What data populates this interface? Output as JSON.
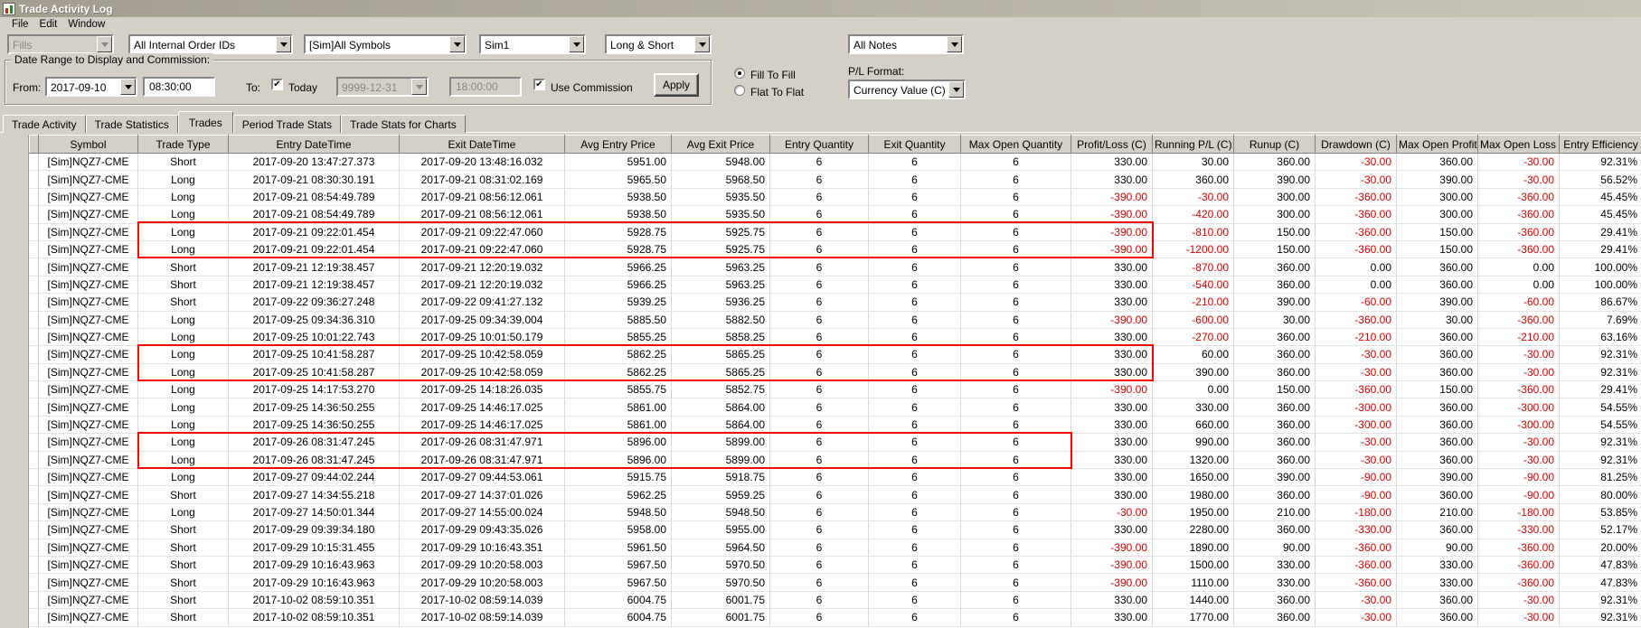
{
  "colors": {
    "negative": "#dd0000",
    "annotation": "#ff0000"
  },
  "window": {
    "title": "Trade Activity Log",
    "menu": [
      "File",
      "Edit",
      "Window"
    ]
  },
  "filters": {
    "fills": "Fills",
    "internal_order_ids": "All Internal Order IDs",
    "symbol": "[Sim]All Symbols",
    "account": "Sim1",
    "direction": "Long & Short",
    "notes": "All Notes"
  },
  "date_range": {
    "group_label": "Date Range to Display and Commission:",
    "from_label": "From:",
    "from_date": "2017-09-10",
    "from_time": "08:30:00",
    "to_label": "To:",
    "today_checkbox": "Today",
    "to_date": "9999-12-31",
    "to_time": "18:00:00",
    "use_commission_checkbox": "Use Commission",
    "apply_button": "Apply"
  },
  "pl_settings": {
    "fill_to_fill": "Fill To Fill",
    "flat_to_flat": "Flat To Flat",
    "format_label": "P/L Format:",
    "format_value": "Currency Value (C)"
  },
  "tabs": {
    "items": [
      "Trade Activity",
      "Trade Statistics",
      "Trades",
      "Period Trade Stats",
      "Trade Stats for Charts"
    ],
    "active": "Trades"
  },
  "table": {
    "columns": [
      "Symbol",
      "Trade Type",
      "Entry DateTime",
      "Exit DateTime",
      "Avg Entry Price",
      "Avg Exit Price",
      "Entry Quantity",
      "Exit Quantity",
      "Max Open Quantity",
      "Profit/Loss (C)",
      "Running P/L (C)",
      "Runup (C)",
      "Drawdown (C)",
      "Max Open Profit (C)",
      "Max Open Loss (C)",
      "Entry Efficiency"
    ],
    "rows": [
      [
        "[Sim]NQZ7-CME",
        "Short",
        "2017-09-20 13:47:27.373",
        "2017-09-20 13:48:16.032",
        "5951.00",
        "5948.00",
        "6",
        "6",
        "6",
        "330.00",
        "30.00",
        "360.00",
        "-30.00",
        "360.00",
        "-30.00",
        "92.31%"
      ],
      [
        "[Sim]NQZ7-CME",
        "Long",
        "2017-09-21 08:30:30.191",
        "2017-09-21 08:31:02.169",
        "5965.50",
        "5968.50",
        "6",
        "6",
        "6",
        "330.00",
        "360.00",
        "390.00",
        "-30.00",
        "390.00",
        "-30.00",
        "56.52%"
      ],
      [
        "[Sim]NQZ7-CME",
        "Long",
        "2017-09-21 08:54:49.789",
        "2017-09-21 08:56:12.061",
        "5938.50",
        "5935.50",
        "6",
        "6",
        "6",
        "-390.00",
        "-30.00",
        "300.00",
        "-360.00",
        "300.00",
        "-360.00",
        "45.45%"
      ],
      [
        "[Sim]NQZ7-CME",
        "Long",
        "2017-09-21 08:54:49.789",
        "2017-09-21 08:56:12.061",
        "5938.50",
        "5935.50",
        "6",
        "6",
        "6",
        "-390.00",
        "-420.00",
        "300.00",
        "-360.00",
        "300.00",
        "-360.00",
        "45.45%"
      ],
      [
        "[Sim]NQZ7-CME",
        "Long",
        "2017-09-21 09:22:01.454",
        "2017-09-21 09:22:47.060",
        "5928.75",
        "5925.75",
        "6",
        "6",
        "6",
        "-390.00",
        "-810.00",
        "150.00",
        "-360.00",
        "150.00",
        "-360.00",
        "29.41%"
      ],
      [
        "[Sim]NQZ7-CME",
        "Long",
        "2017-09-21 09:22:01.454",
        "2017-09-21 09:22:47.060",
        "5928.75",
        "5925.75",
        "6",
        "6",
        "6",
        "-390.00",
        "-1200.00",
        "150.00",
        "-360.00",
        "150.00",
        "-360.00",
        "29.41%"
      ],
      [
        "[Sim]NQZ7-CME",
        "Short",
        "2017-09-21 12:19:38.457",
        "2017-09-21 12:20:19.032",
        "5966.25",
        "5963.25",
        "6",
        "6",
        "6",
        "330.00",
        "-870.00",
        "360.00",
        "0.00",
        "360.00",
        "0.00",
        "100.00%"
      ],
      [
        "[Sim]NQZ7-CME",
        "Short",
        "2017-09-21 12:19:38.457",
        "2017-09-21 12:20:19.032",
        "5966.25",
        "5963.25",
        "6",
        "6",
        "6",
        "330.00",
        "-540.00",
        "360.00",
        "0.00",
        "360.00",
        "0.00",
        "100.00%"
      ],
      [
        "[Sim]NQZ7-CME",
        "Short",
        "2017-09-22 09:36:27.248",
        "2017-09-22 09:41:27.132",
        "5939.25",
        "5936.25",
        "6",
        "6",
        "6",
        "330.00",
        "-210.00",
        "390.00",
        "-60.00",
        "390.00",
        "-60.00",
        "86.67%"
      ],
      [
        "[Sim]NQZ7-CME",
        "Long",
        "2017-09-25 09:34:36.310",
        "2017-09-25 09:34:39.004",
        "5885.50",
        "5882.50",
        "6",
        "6",
        "6",
        "-390.00",
        "-600.00",
        "30.00",
        "-360.00",
        "30.00",
        "-360.00",
        "7.69%"
      ],
      [
        "[Sim]NQZ7-CME",
        "Long",
        "2017-09-25 10:01:22.743",
        "2017-09-25 10:01:50.179",
        "5855.25",
        "5858.25",
        "6",
        "6",
        "6",
        "330.00",
        "-270.00",
        "360.00",
        "-210.00",
        "360.00",
        "-210.00",
        "63.16%"
      ],
      [
        "[Sim]NQZ7-CME",
        "Long",
        "2017-09-25 10:41:58.287",
        "2017-09-25 10:42:58.059",
        "5862.25",
        "5865.25",
        "6",
        "6",
        "6",
        "330.00",
        "60.00",
        "360.00",
        "-30.00",
        "360.00",
        "-30.00",
        "92.31%"
      ],
      [
        "[Sim]NQZ7-CME",
        "Long",
        "2017-09-25 10:41:58.287",
        "2017-09-25 10:42:58.059",
        "5862.25",
        "5865.25",
        "6",
        "6",
        "6",
        "330.00",
        "390.00",
        "360.00",
        "-30.00",
        "360.00",
        "-30.00",
        "92.31%"
      ],
      [
        "[Sim]NQZ7-CME",
        "Long",
        "2017-09-25 14:17:53.270",
        "2017-09-25 14:18:26.035",
        "5855.75",
        "5852.75",
        "6",
        "6",
        "6",
        "-390.00",
        "0.00",
        "150.00",
        "-360.00",
        "150.00",
        "-360.00",
        "29.41%"
      ],
      [
        "[Sim]NQZ7-CME",
        "Long",
        "2017-09-25 14:36:50.255",
        "2017-09-25 14:46:17.025",
        "5861.00",
        "5864.00",
        "6",
        "6",
        "6",
        "330.00",
        "330.00",
        "360.00",
        "-300.00",
        "360.00",
        "-300.00",
        "54.55%"
      ],
      [
        "[Sim]NQZ7-CME",
        "Long",
        "2017-09-25 14:36:50.255",
        "2017-09-25 14:46:17.025",
        "5861.00",
        "5864.00",
        "6",
        "6",
        "6",
        "330.00",
        "660.00",
        "360.00",
        "-300.00",
        "360.00",
        "-300.00",
        "54.55%"
      ],
      [
        "[Sim]NQZ7-CME",
        "Long",
        "2017-09-26 08:31:47.245",
        "2017-09-26 08:31:47.971",
        "5896.00",
        "5899.00",
        "6",
        "6",
        "6",
        "330.00",
        "990.00",
        "360.00",
        "-30.00",
        "360.00",
        "-30.00",
        "92.31%"
      ],
      [
        "[Sim]NQZ7-CME",
        "Long",
        "2017-09-26 08:31:47.245",
        "2017-09-26 08:31:47.971",
        "5896.00",
        "5899.00",
        "6",
        "6",
        "6",
        "330.00",
        "1320.00",
        "360.00",
        "-30.00",
        "360.00",
        "-30.00",
        "92.31%"
      ],
      [
        "[Sim]NQZ7-CME",
        "Long",
        "2017-09-27 09:44:02.244",
        "2017-09-27 09:44:53.061",
        "5915.75",
        "5918.75",
        "6",
        "6",
        "6",
        "330.00",
        "1650.00",
        "390.00",
        "-90.00",
        "390.00",
        "-90.00",
        "81.25%"
      ],
      [
        "[Sim]NQZ7-CME",
        "Short",
        "2017-09-27 14:34:55.218",
        "2017-09-27 14:37:01.026",
        "5962.25",
        "5959.25",
        "6",
        "6",
        "6",
        "330.00",
        "1980.00",
        "360.00",
        "-90.00",
        "360.00",
        "-90.00",
        "80.00%"
      ],
      [
        "[Sim]NQZ7-CME",
        "Long",
        "2017-09-27 14:50:01.344",
        "2017-09-27 14:55:00.024",
        "5948.50",
        "5948.50",
        "6",
        "6",
        "6",
        "-30.00",
        "1950.00",
        "210.00",
        "-180.00",
        "210.00",
        "-180.00",
        "53.85%"
      ],
      [
        "[Sim]NQZ7-CME",
        "Short",
        "2017-09-29 09:39:34.180",
        "2017-09-29 09:43:35.026",
        "5958.00",
        "5955.00",
        "6",
        "6",
        "6",
        "330.00",
        "2280.00",
        "360.00",
        "-330.00",
        "360.00",
        "-330.00",
        "52.17%"
      ],
      [
        "[Sim]NQZ7-CME",
        "Short",
        "2017-09-29 10:15:31.455",
        "2017-09-29 10:16:43.351",
        "5961.50",
        "5964.50",
        "6",
        "6",
        "6",
        "-390.00",
        "1890.00",
        "90.00",
        "-360.00",
        "90.00",
        "-360.00",
        "20.00%"
      ],
      [
        "[Sim]NQZ7-CME",
        "Short",
        "2017-09-29 10:16:43.963",
        "2017-09-29 10:20:58.003",
        "5967.50",
        "5970.50",
        "6",
        "6",
        "6",
        "-390.00",
        "1500.00",
        "330.00",
        "-360.00",
        "330.00",
        "-360.00",
        "47.83%"
      ],
      [
        "[Sim]NQZ7-CME",
        "Short",
        "2017-09-29 10:16:43.963",
        "2017-09-29 10:20:58.003",
        "5967.50",
        "5970.50",
        "6",
        "6",
        "6",
        "-390.00",
        "1110.00",
        "330.00",
        "-360.00",
        "330.00",
        "-360.00",
        "47.83%"
      ],
      [
        "[Sim]NQZ7-CME",
        "Short",
        "2017-10-02 08:59:10.351",
        "2017-10-02 08:59:14.039",
        "6004.75",
        "6001.75",
        "6",
        "6",
        "6",
        "330.00",
        "1440.00",
        "360.00",
        "-30.00",
        "360.00",
        "-30.00",
        "92.31%"
      ],
      [
        "[Sim]NQZ7-CME",
        "Short",
        "2017-10-02 08:59:10.351",
        "2017-10-02 08:59:14.039",
        "6004.75",
        "6001.75",
        "6",
        "6",
        "6",
        "330.00",
        "1770.00",
        "360.00",
        "-30.00",
        "360.00",
        "-30.00",
        "92.31%"
      ]
    ]
  },
  "annotations": {
    "boxes": [
      {
        "from_row": 5,
        "to_row": 6,
        "from_col": 2,
        "to_col": 10
      },
      {
        "from_row": 12,
        "to_row": 13,
        "from_col": 2,
        "to_col": 10
      },
      {
        "from_row": 17,
        "to_row": 18,
        "from_col": 2,
        "to_col": 9
      }
    ]
  }
}
